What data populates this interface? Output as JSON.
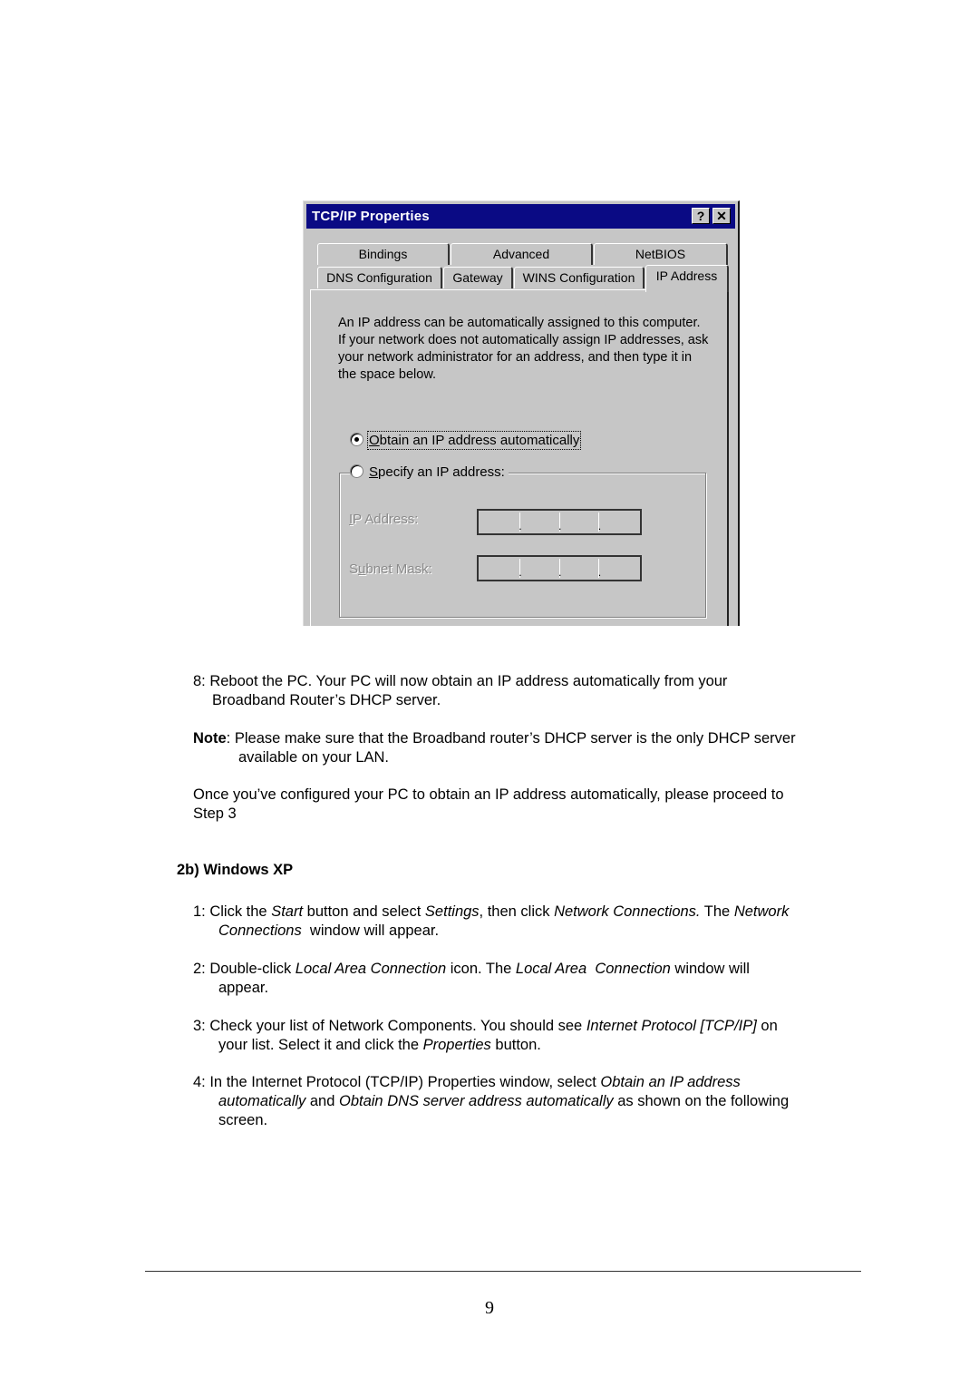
{
  "dialog": {
    "title": "TCP/IP Properties",
    "help_button": "?",
    "close_button": "✕",
    "tabs_row1": [
      "Bindings",
      "Advanced",
      "NetBIOS"
    ],
    "tabs_row2": [
      "DNS Configuration",
      "Gateway",
      "WINS Configuration"
    ],
    "active_tab": "IP Address",
    "description": [
      "An IP address can be automatically assigned to this computer.",
      "If your network does not automatically assign IP addresses, ask",
      "your network administrator for an address, and then type it in",
      "the space below."
    ],
    "radio_obtain": {
      "accel": "O",
      "rest": "btain an IP address automatically",
      "checked": true
    },
    "radio_specify": {
      "accel": "S",
      "rest": "pecify an IP address:",
      "checked": false
    },
    "ip_address_label": {
      "accel": "I",
      "rest": "P Address:"
    },
    "subnet_mask_label": {
      "pre": "S",
      "accel": "u",
      "rest": "bnet Mask:"
    },
    "ip_address_value": [
      "",
      "",
      "",
      ""
    ],
    "subnet_mask_value": [
      "",
      "",
      "",
      ""
    ]
  },
  "doc": {
    "step8": {
      "line1": "8: Reboot the PC. Your PC will now obtain an IP address automatically from your",
      "line2": "Broadband Router’s DHCP server."
    },
    "note": {
      "label": "Note",
      "line1": ": Please make sure that the Broadband router’s DHCP server is the only DHCP server",
      "line2": "available on your LAN."
    },
    "once": {
      "line1": "Once you’ve configured your PC to obtain an IP address automatically, please proceed to",
      "line2": "Step 3"
    },
    "heading": "2b) Windows XP",
    "xp_step1": {
      "a": "1: Click the ",
      "b": "Start",
      "c": " button and select ",
      "d": "Settings",
      "e": ", then click ",
      "f": "Network Connections.",
      "g": " The ",
      "h": "Network",
      "i": "Connections",
      "j": "  window will appear."
    },
    "xp_step2": {
      "a": "2: Double-click ",
      "b": "Local Area Connection",
      "c": " icon. The ",
      "d": "Local Area  Connection",
      "e": " window will",
      "f": "appear."
    },
    "xp_step3": {
      "a": "3: Check your list of Network Components. You should see ",
      "b": "Internet Protocol [TCP/IP]",
      "c": " on",
      "d": "your list. Select it and click the ",
      "e": "Properties",
      "f": " button."
    },
    "xp_step4": {
      "a": "4: In the Internet Protocol (TCP/IP) Properties window, select ",
      "b": "Obtain an IP address",
      "c": "automatically",
      "d": " and ",
      "e": "Obtain DNS server address automatically",
      "f": " as shown on the following",
      "g": "screen."
    },
    "page_number": "9"
  }
}
